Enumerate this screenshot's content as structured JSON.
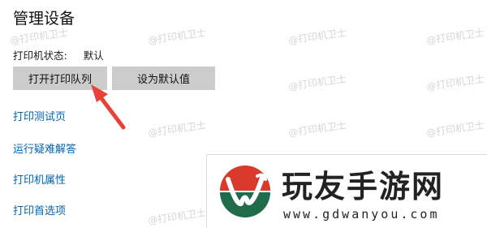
{
  "page": {
    "title": "管理设备"
  },
  "status": {
    "label": "打印机状态:",
    "value": "默认"
  },
  "buttons": {
    "open_queue": "打开打印队列",
    "set_default": "设为默认值"
  },
  "links": [
    {
      "label": "打印测试页"
    },
    {
      "label": "运行疑难解答"
    },
    {
      "label": "打印机属性"
    },
    {
      "label": "打印首选项"
    }
  ],
  "watermark": {
    "text": "@打印机卫士"
  },
  "promo": {
    "brand": "玩友手游网",
    "domain": "www.gdwanyou.com"
  },
  "colors": {
    "link": "#0063b1",
    "button_bg": "#cccccc",
    "arrow": "#e8413a",
    "logo_red": "#d93a2b",
    "logo_green": "#1f6b4a"
  }
}
